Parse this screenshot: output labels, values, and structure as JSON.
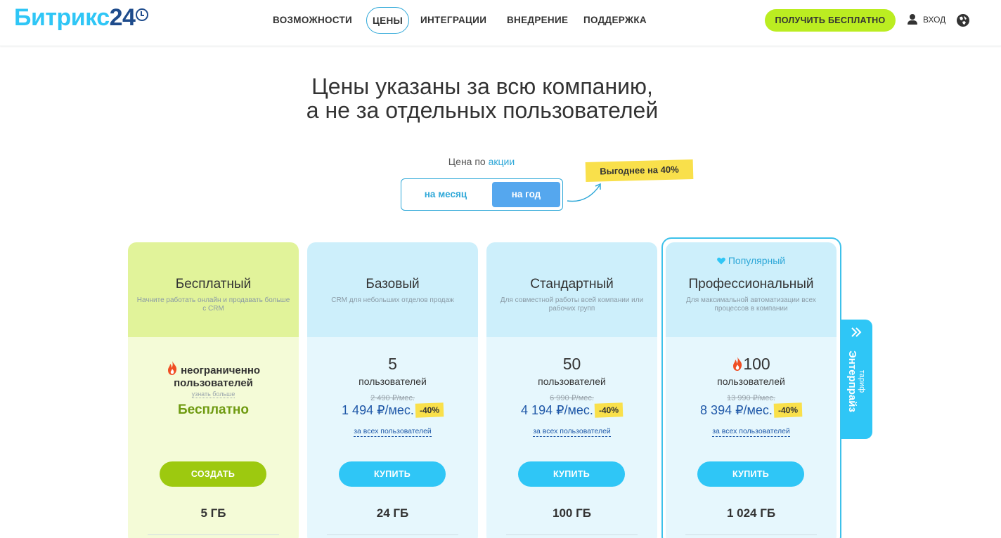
{
  "header": {
    "logo": {
      "text": "Битрикс",
      "num": "24"
    },
    "nav": [
      {
        "label": "ВОЗМОЖНОСТИ"
      },
      {
        "label": "ЦЕНЫ"
      },
      {
        "label": "ИНТЕГРАЦИИ"
      },
      {
        "label": "ВНЕДРЕНИЕ"
      },
      {
        "label": "ПОДДЕРЖКА"
      }
    ],
    "cta_label": "ПОЛУЧИТЬ БЕСПЛАТНО",
    "login_label": "ВХОД"
  },
  "heading": {
    "line1": "Цены указаны за всю компанию,",
    "line2": "а не за отдельных пользователей"
  },
  "pricing": {
    "label_prefix": "Цена по",
    "label_accent": "акции",
    "toggle": {
      "month": "на месяц",
      "year": "на год",
      "selected": "year"
    },
    "promo": "Выгоднее на 40%"
  },
  "plans": [
    {
      "title": "Бесплатный",
      "desc": "Начните работать онлайн и продавать больше с CRM",
      "users_line1": "неограниченно",
      "users_line2": "пользователей",
      "learn_more": "узнать больше",
      "price": "Бесплатно",
      "button": "СОЗДАТЬ",
      "storage": "5 ГБ"
    },
    {
      "title": "Базовый",
      "desc": "CRM для небольших отделов продаж",
      "users": "5",
      "users_label": "пользователей",
      "old_price": "2 490 ₽/мес.",
      "price": "1 494 ₽/мес.",
      "discount": "-40%",
      "per_all": "за всех пользователей",
      "button": "КУПИТЬ",
      "storage": "24 ГБ"
    },
    {
      "title": "Стандартный",
      "desc": "Для совместной работы всей компании или рабочих групп",
      "users": "50",
      "users_label": "пользователей",
      "old_price": "6 990 ₽/мес.",
      "price": "4 194 ₽/мес.",
      "discount": "-40%",
      "per_all": "за всех пользователей",
      "button": "КУПИТЬ",
      "storage": "100 ГБ"
    },
    {
      "title": "Профессиональный",
      "badge": "Популярный",
      "desc": "Для максимальной автоматизации всех процессов в компании",
      "users": "100",
      "users_label": "пользователей",
      "old_price": "13 990 ₽/мес.",
      "price": "8 394 ₽/мес.",
      "discount": "-40%",
      "per_all": "за всех пользователей",
      "button": "КУПИТЬ",
      "storage": "1 024 ГБ"
    }
  ],
  "enterprise": {
    "small": "тариф",
    "big": "Энтерпрайз"
  },
  "colors": {
    "brand": "#2fc6f6",
    "brand_dark": "#1f4c8c",
    "cta": "#bbed21",
    "free_green": "#9dc90f",
    "promo_yellow": "#f9e04b",
    "price_blue": "#1f58a8"
  },
  "icons": [
    "user-icon",
    "globe-icon",
    "fire-icon",
    "heart-icon",
    "double-chevron-icon",
    "curved-arrow-icon",
    "clock-icon"
  ]
}
